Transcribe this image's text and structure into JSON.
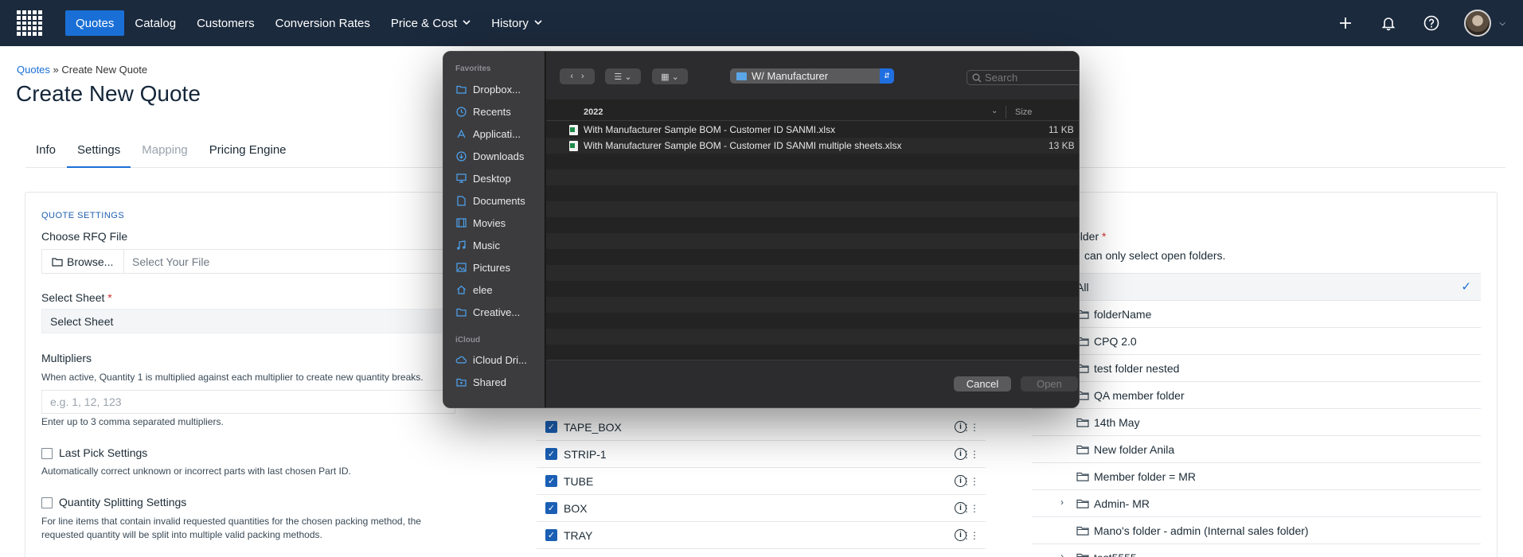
{
  "nav": {
    "items": [
      {
        "label": "Quotes",
        "active": true,
        "dropdown": false
      },
      {
        "label": "Catalog",
        "active": false,
        "dropdown": false
      },
      {
        "label": "Customers",
        "active": false,
        "dropdown": false
      },
      {
        "label": "Conversion Rates",
        "active": false,
        "dropdown": false
      },
      {
        "label": "Price & Cost",
        "active": false,
        "dropdown": true
      },
      {
        "label": "History",
        "active": false,
        "dropdown": true
      }
    ],
    "icons": [
      "plus-icon",
      "bell-icon",
      "help-icon"
    ]
  },
  "breadcrumb": {
    "parent": "Quotes",
    "separator": " » ",
    "current": "Create New Quote"
  },
  "page_title": "Create New Quote",
  "tabs": [
    {
      "label": "Info",
      "state": "normal"
    },
    {
      "label": "Settings",
      "state": "active"
    },
    {
      "label": "Mapping",
      "state": "disabled"
    },
    {
      "label": "Pricing Engine",
      "state": "normal"
    }
  ],
  "settings": {
    "section_label": "QUOTE SETTINGS",
    "rfq_label": "Choose RFQ File",
    "browse_label": "Browse...",
    "file_placeholder": "Select Your File",
    "sheet_label": "Select Sheet",
    "required_mark": "*",
    "sheet_value": "Select Sheet",
    "multipliers_label": "Multipliers",
    "multipliers_help": "When active, Quantity 1 is multiplied against each multiplier to create new quantity breaks.",
    "multipliers_placeholder": "e.g. 1, 12, 123",
    "multipliers_hint": "Enter up to 3 comma separated multipliers.",
    "last_pick_label": "Last Pick Settings",
    "last_pick_help": "Automatically correct unknown or incorrect parts with last chosen Part ID.",
    "qty_split_label": "Quantity Splitting Settings",
    "qty_split_help_1": "For line items that contain invalid requested quantities for the chosen packing method, the",
    "qty_split_help_2": "requested quantity will be split into multiple valid packing methods."
  },
  "packing": {
    "items": [
      "TAPE_BOX",
      "STRIP-1",
      "TUBE",
      "BOX",
      "TRAY"
    ]
  },
  "folders": {
    "label": "older",
    "required_mark": "*",
    "help": "can only select open folders.",
    "items": [
      {
        "label": "All",
        "selected": true,
        "expandable": false
      },
      {
        "label": "folderName",
        "selected": false,
        "expandable": false
      },
      {
        "label": "CPQ 2.0",
        "selected": false,
        "expandable": false
      },
      {
        "label": "test folder nested",
        "selected": false,
        "expandable": false
      },
      {
        "label": "QA member folder",
        "selected": false,
        "expandable": false
      },
      {
        "label": "14th May",
        "selected": false,
        "expandable": false
      },
      {
        "label": "New folder Anila",
        "selected": false,
        "expandable": false
      },
      {
        "label": "Member folder = MR",
        "selected": false,
        "expandable": false
      },
      {
        "label": "Admin- MR",
        "selected": false,
        "expandable": true
      },
      {
        "label": "Mano's folder - admin (Internal sales folder)",
        "selected": false,
        "expandable": false
      },
      {
        "label": "test5555",
        "selected": false,
        "expandable": true
      }
    ]
  },
  "dialog": {
    "favorites_label": "Favorites",
    "favorites": [
      {
        "label": "Dropbox...",
        "icon": "folder-icon"
      },
      {
        "label": "Recents",
        "icon": "clock-icon"
      },
      {
        "label": "Applicati...",
        "icon": "applications-icon"
      },
      {
        "label": "Downloads",
        "icon": "download-icon"
      },
      {
        "label": "Desktop",
        "icon": "desktop-icon"
      },
      {
        "label": "Documents",
        "icon": "document-icon"
      },
      {
        "label": "Movies",
        "icon": "film-icon"
      },
      {
        "label": "Music",
        "icon": "music-icon"
      },
      {
        "label": "Pictures",
        "icon": "picture-icon"
      },
      {
        "label": "elee",
        "icon": "home-icon"
      },
      {
        "label": "Creative...",
        "icon": "folder-icon"
      }
    ],
    "icloud_label": "iCloud",
    "icloud": [
      {
        "label": "iCloud Dri...",
        "icon": "cloud-icon"
      },
      {
        "label": "Shared",
        "icon": "shared-folder-icon"
      }
    ],
    "location": "W/ Manufacturer",
    "search_placeholder": "Search",
    "column_name": "2022",
    "column_size": "Size",
    "files": [
      {
        "name": "With Manufacturer Sample BOM - Customer ID SANMI.xlsx",
        "size": "11 KB"
      },
      {
        "name": "With Manufacturer Sample BOM - Customer ID SANMI multiple sheets.xlsx",
        "size": "13 KB"
      }
    ],
    "cancel_label": "Cancel",
    "open_label": "Open"
  },
  "colors": {
    "nav_bg": "#1b2a3d",
    "accent": "#1a6fd6",
    "dialog_bg": "#1e1e1e"
  }
}
